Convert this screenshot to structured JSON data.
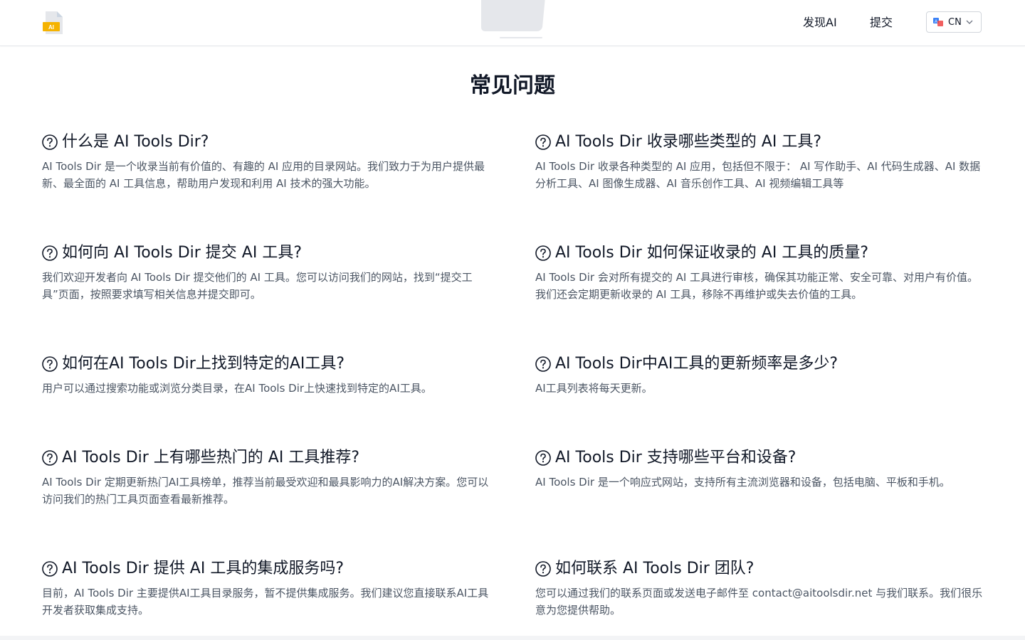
{
  "header": {
    "logo_label": "AI",
    "nav": {
      "discover": "发现AI",
      "submit": "提交"
    },
    "language": {
      "selected": "CN"
    }
  },
  "main": {
    "title": "常见问题",
    "faqs": [
      {
        "question": "什么是 AI Tools Dir?",
        "answer": "AI Tools Dir 是一个收录当前有价值的、有趣的 AI 应用的目录网站。我们致力于为用户提供最新、最全面的 AI 工具信息，帮助用户发现和利用 AI 技术的强大功能。"
      },
      {
        "question": "AI Tools Dir 收录哪些类型的 AI 工具?",
        "answer": "AI Tools Dir 收录各种类型的 AI 应用，包括但不限于： AI 写作助手、AI 代码生成器、AI 数据分析工具、AI 图像生成器、AI 音乐创作工具、AI 视频编辑工具等"
      },
      {
        "question": "如何向 AI Tools Dir 提交 AI 工具?",
        "answer": "我们欢迎开发者向 AI Tools Dir 提交他们的 AI 工具。您可以访问我们的网站，找到“提交工具”页面，按照要求填写相关信息并提交即可。"
      },
      {
        "question": "AI Tools Dir 如何保证收录的 AI 工具的质量?",
        "answer": "AI Tools Dir 会对所有提交的 AI 工具进行审核，确保其功能正常、安全可靠、对用户有价值。我们还会定期更新收录的 AI 工具，移除不再维护或失去价值的工具。"
      },
      {
        "question": "如何在AI Tools Dir上找到特定的AI工具?",
        "answer": "用户可以通过搜索功能或浏览分类目录，在AI Tools Dir上快速找到特定的AI工具。"
      },
      {
        "question": "AI Tools Dir中AI工具的更新频率是多少?",
        "answer": "AI工具列表将每天更新。"
      },
      {
        "question": "AI Tools Dir 上有哪些热门的 AI 工具推荐?",
        "answer": "AI Tools Dir 定期更新热门AI工具榜单，推荐当前最受欢迎和最具影响力的AI解决方案。您可以访问我们的热门工具页面查看最新推荐。"
      },
      {
        "question": "AI Tools Dir 支持哪些平台和设备?",
        "answer": "AI Tools Dir 是一个响应式网站，支持所有主流浏览器和设备，包括电脑、平板和手机。"
      },
      {
        "question": "AI Tools Dir 提供 AI 工具的集成服务吗?",
        "answer": "目前，AI Tools Dir 主要提供AI工具目录服务，暂不提供集成服务。我们建议您直接联系AI工具开发者获取集成支持。"
      },
      {
        "question": "如何联系 AI Tools Dir 团队?",
        "answer": "您可以通过我们的联系页面或发送电子邮件至 contact@aitoolsdir.net 与我们联系。我们很乐意为您提供帮助。"
      }
    ]
  },
  "colors": {
    "text": "#111827",
    "muted": "#4b5563",
    "border": "#e5e7eb",
    "logo_yellow": "#f5b301"
  }
}
